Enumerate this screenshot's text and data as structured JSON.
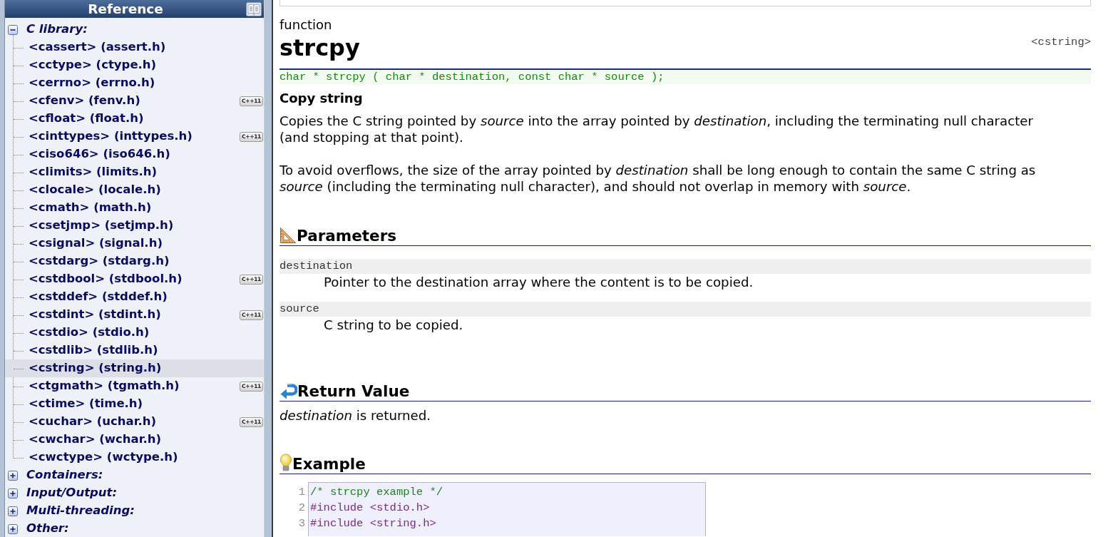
{
  "sidebar": {
    "title": "Reference",
    "groups": [
      {
        "label": "C library:",
        "expanded": true,
        "children": [
          {
            "label": "<cassert> (assert.h)",
            "selected": false
          },
          {
            "label": "<cctype> (ctype.h)",
            "selected": false
          },
          {
            "label": "<cerrno> (errno.h)",
            "selected": false
          },
          {
            "label": "<cfenv> (fenv.h)",
            "selected": false,
            "badge": "C++11"
          },
          {
            "label": "<cfloat> (float.h)",
            "selected": false
          },
          {
            "label": "<cinttypes> (inttypes.h)",
            "selected": false,
            "badge": "C++11"
          },
          {
            "label": "<ciso646> (iso646.h)",
            "selected": false
          },
          {
            "label": "<climits> (limits.h)",
            "selected": false
          },
          {
            "label": "<clocale> (locale.h)",
            "selected": false
          },
          {
            "label": "<cmath> (math.h)",
            "selected": false
          },
          {
            "label": "<csetjmp> (setjmp.h)",
            "selected": false
          },
          {
            "label": "<csignal> (signal.h)",
            "selected": false
          },
          {
            "label": "<cstdarg> (stdarg.h)",
            "selected": false
          },
          {
            "label": "<cstdbool> (stdbool.h)",
            "selected": false,
            "badge": "C++11"
          },
          {
            "label": "<cstddef> (stddef.h)",
            "selected": false
          },
          {
            "label": "<cstdint> (stdint.h)",
            "selected": false,
            "badge": "C++11"
          },
          {
            "label": "<cstdio> (stdio.h)",
            "selected": false
          },
          {
            "label": "<cstdlib> (stdlib.h)",
            "selected": false
          },
          {
            "label": "<cstring> (string.h)",
            "selected": true
          },
          {
            "label": "<ctgmath> (tgmath.h)",
            "selected": false,
            "badge": "C++11"
          },
          {
            "label": "<ctime> (time.h)",
            "selected": false
          },
          {
            "label": "<cuchar> (uchar.h)",
            "selected": false,
            "badge": "C++11"
          },
          {
            "label": "<cwchar> (wchar.h)",
            "selected": false
          },
          {
            "label": "<cwctype> (wctype.h)",
            "selected": false
          }
        ]
      },
      {
        "label": "Containers:",
        "expanded": false
      },
      {
        "label": "Input/Output:",
        "expanded": false
      },
      {
        "label": "Multi-threading:",
        "expanded": false
      },
      {
        "label": "Other:",
        "expanded": false
      }
    ]
  },
  "article": {
    "category": "function",
    "title": "strcpy",
    "header": "<cstring>",
    "prototype": "char * strcpy ( char * destination, const char * source );",
    "subtitle": "Copy string",
    "paragraphs": [
      "Copies the C string pointed by *source* into the array pointed by *destination*, including the terminating null character (and stopping at that point).",
      "To avoid overflows, the size of the array pointed by *destination* shall be long enough to contain the same C string as *source* (including the terminating null character), and should not overlap in memory with *source*."
    ],
    "sections": [
      {
        "kind": "parameters",
        "heading": "Parameters",
        "params": [
          {
            "name": "destination",
            "text": "Pointer to the destination array where the content is to be copied."
          },
          {
            "name": "source",
            "text": "C string to be copied."
          }
        ]
      },
      {
        "kind": "return",
        "heading": "Return Value",
        "text": "*destination* is returned."
      },
      {
        "kind": "example",
        "heading": "Example",
        "code": [
          {
            "number": "1",
            "kind": "comment",
            "text": "/* strcpy example */"
          },
          {
            "number": "2",
            "kind": "preprocessor",
            "text": "#include <stdio.h>"
          },
          {
            "number": "3",
            "kind": "preprocessor",
            "text": "#include <string.h>"
          }
        ]
      }
    ]
  }
}
